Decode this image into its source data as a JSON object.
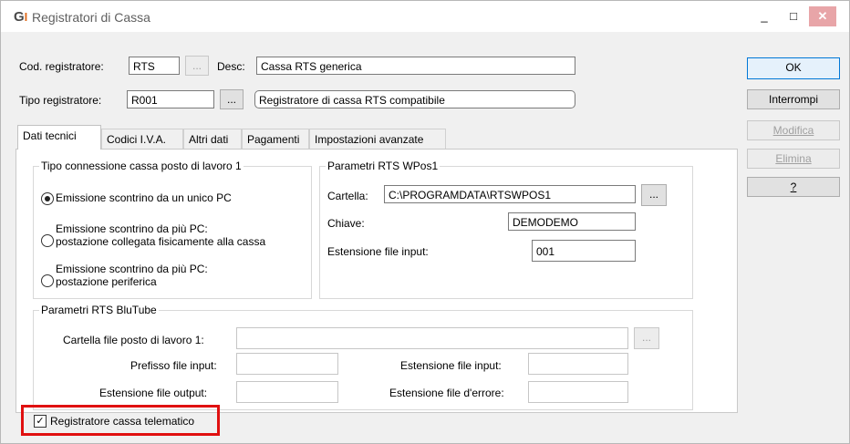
{
  "window": {
    "title": "Registratori di Cassa",
    "icon_text": "G",
    "icon_bar": "I",
    "minimize_label": "_",
    "maximize_label": "□",
    "close_label": "✕"
  },
  "header": {
    "cod_label": "Cod. registratore:",
    "cod_value": "RTS",
    "cod_lookup_label": "...",
    "desc_label": "Desc:",
    "desc_value": "Cassa RTS generica",
    "tipo_label": "Tipo registratore:",
    "tipo_value": "R001",
    "tipo_lookup_label": "...",
    "tipo_desc_value": "Registratore di cassa RTS compatibile"
  },
  "side_buttons": {
    "ok": "OK",
    "interrompi": "Interrompi",
    "modifica": "Modifica",
    "elimina": "Elimina",
    "help": "?"
  },
  "tabs": [
    {
      "label": "Dati tecnici",
      "active": true
    },
    {
      "label": "Codici I.V.A.",
      "active": false
    },
    {
      "label": "Altri dati",
      "active": false
    },
    {
      "label": "Pagamenti",
      "active": false
    },
    {
      "label": "Impostazioni avanzate",
      "active": false
    }
  ],
  "connessione": {
    "title": "Tipo connessione cassa posto di lavoro 1",
    "options": [
      {
        "line1": "Emissione scontrino da un unico PC",
        "line2": "",
        "selected": true
      },
      {
        "line1": "Emissione scontrino da più PC:",
        "line2": "postazione collegata fisicamente alla cassa",
        "selected": false
      },
      {
        "line1": "Emissione scontrino da più PC:",
        "line2": "postazione periferica",
        "selected": false
      }
    ]
  },
  "wpos": {
    "title": "Parametri RTS WPos1",
    "cartella_label": "Cartella:",
    "cartella_value": "C:\\PROGRAMDATA\\RTSWPOS1",
    "cartella_lookup_label": "...",
    "chiave_label": "Chiave:",
    "chiave_value": "DEMODEMO",
    "estensione_label": "Estensione file input:",
    "estensione_value": "001"
  },
  "blutube": {
    "title": "Parametri RTS BluTube",
    "cartella_label": "Cartella file posto di lavoro 1:",
    "cartella_value": "",
    "cartella_lookup_label": "...",
    "prefisso_label": "Prefisso file input:",
    "prefisso_value": "",
    "est_input_label": "Estensione file input:",
    "est_input_value": "",
    "est_output_label": "Estensione file output:",
    "est_output_value": "",
    "est_errore_label": "Estensione file d'errore:",
    "est_errore_value": ""
  },
  "telematico": {
    "label": "Registratore cassa telematico",
    "checked": true,
    "check_mark": "✓"
  },
  "colors": {
    "highlight_border": "#e01010",
    "primary_border": "#0078d7",
    "close_button": "#e8a5a8"
  }
}
